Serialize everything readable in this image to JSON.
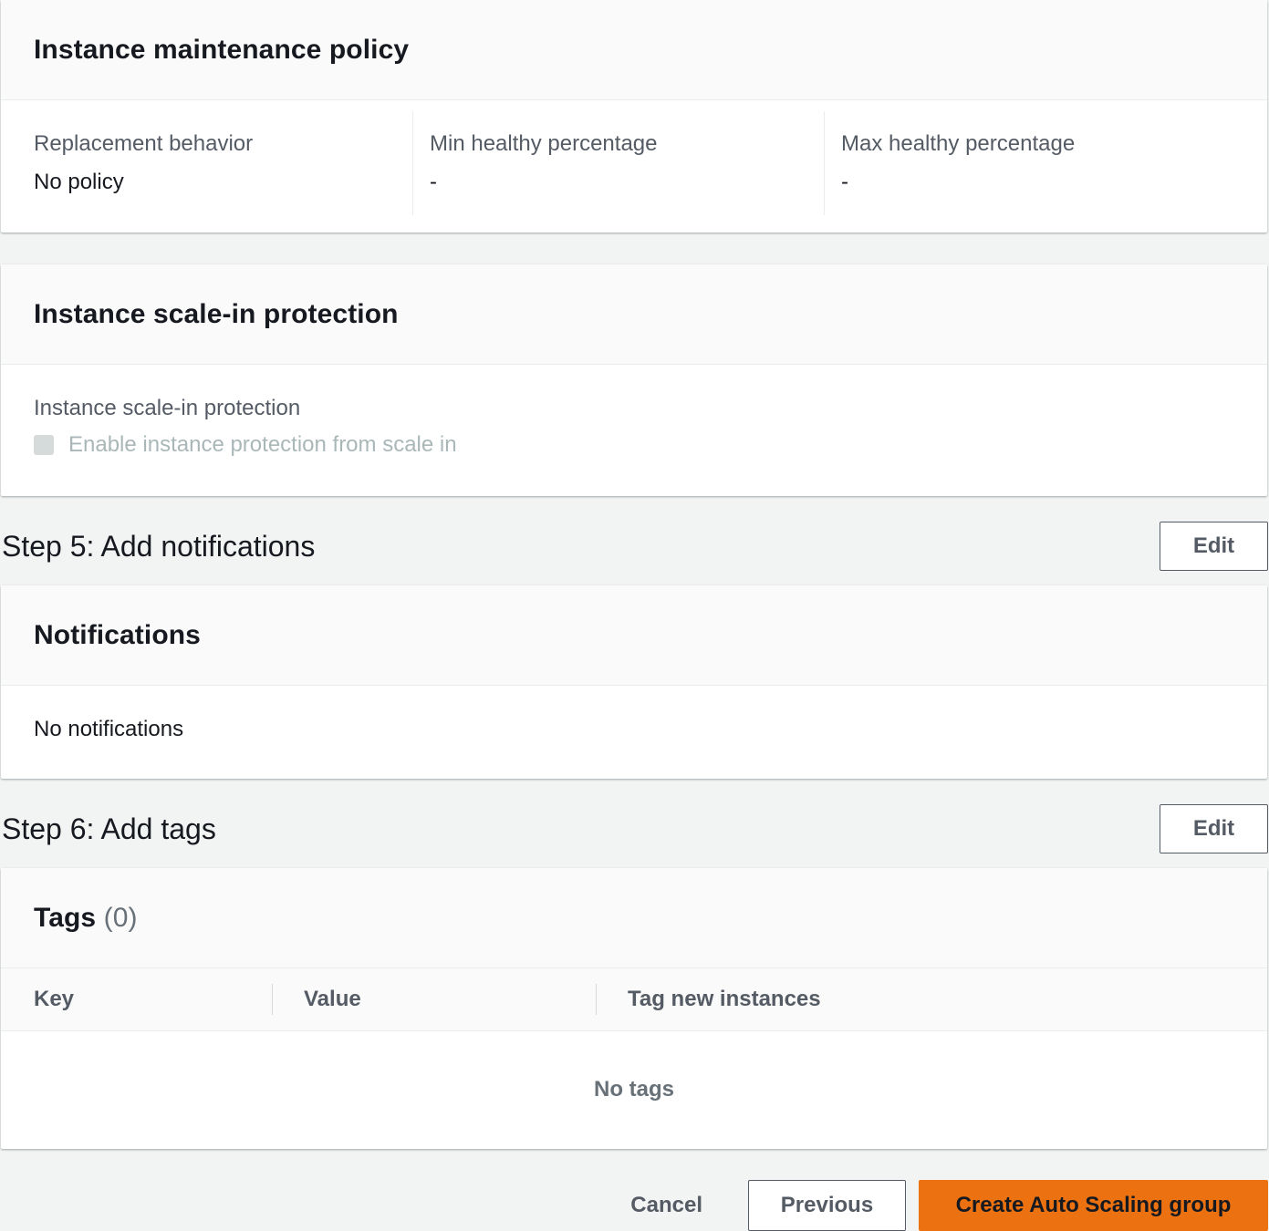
{
  "maintenance": {
    "title": "Instance maintenance policy",
    "fields": [
      {
        "label": "Replacement behavior",
        "value": "No policy"
      },
      {
        "label": "Min healthy percentage",
        "value": "-"
      },
      {
        "label": "Max healthy percentage",
        "value": "-"
      }
    ]
  },
  "scale_in": {
    "title": "Instance scale-in protection",
    "field_label": "Instance scale-in protection",
    "checkbox_label": "Enable instance protection from scale in",
    "checked": false,
    "disabled": true
  },
  "step5": {
    "heading": "Step 5: Add notifications",
    "edit_label": "Edit",
    "panel_title": "Notifications",
    "empty_text": "No notifications"
  },
  "step6": {
    "heading": "Step 6: Add tags",
    "edit_label": "Edit",
    "panel_title": "Tags",
    "count": "(0)",
    "columns": [
      "Key",
      "Value",
      "Tag new instances"
    ],
    "empty_text": "No tags"
  },
  "footer": {
    "cancel_label": "Cancel",
    "previous_label": "Previous",
    "create_label": "Create Auto Scaling group"
  },
  "colors": {
    "background": "#f2f3f3",
    "primary_button": "#ec7211",
    "text": "#16191f",
    "secondary_text": "#545b64"
  }
}
